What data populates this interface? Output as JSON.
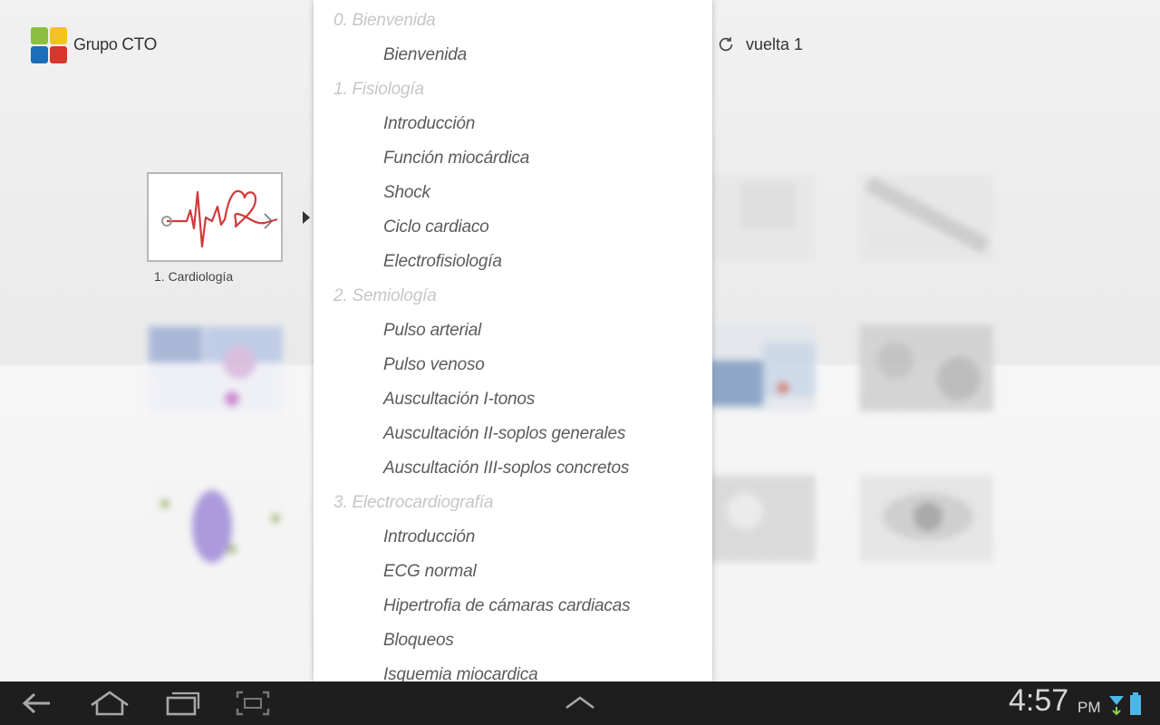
{
  "header": {
    "brand_prefix": "Grupo",
    "brand_name": "CTO",
    "lap_label": "vuelta 1"
  },
  "tiles": [
    {
      "label": "1. Cardiología",
      "selected": true
    },
    {
      "label": "",
      "selected": false
    }
  ],
  "menu": {
    "items": [
      {
        "type": "section",
        "label": "0. Bienvenida"
      },
      {
        "type": "topic",
        "label": "Bienvenida"
      },
      {
        "type": "section",
        "label": "1. Fisiología"
      },
      {
        "type": "topic",
        "label": "Introducción"
      },
      {
        "type": "topic",
        "label": "Función miocárdica"
      },
      {
        "type": "topic",
        "label": "Shock"
      },
      {
        "type": "topic",
        "label": "Ciclo cardiaco"
      },
      {
        "type": "topic",
        "label": "Electrofisiología"
      },
      {
        "type": "section",
        "label": "2. Semiología"
      },
      {
        "type": "topic",
        "label": "Pulso arterial"
      },
      {
        "type": "topic",
        "label": "Pulso venoso"
      },
      {
        "type": "topic",
        "label": "Auscultación I-tonos"
      },
      {
        "type": "topic",
        "label": "Auscultación II-soplos generales"
      },
      {
        "type": "topic",
        "label": "Auscultación III-soplos concretos"
      },
      {
        "type": "section",
        "label": "3. Electrocardiografía"
      },
      {
        "type": "topic",
        "label": "Introducción"
      },
      {
        "type": "topic",
        "label": "ECG normal"
      },
      {
        "type": "topic",
        "label": "Hipertrofia de cámaras cardiacas"
      },
      {
        "type": "topic",
        "label": "Bloqueos"
      },
      {
        "type": "topic",
        "label": "Isquemia miocardica"
      }
    ]
  },
  "statusbar": {
    "time": "4:57",
    "ampm": "PM"
  },
  "colors": {
    "brand_green": "#8cbf3f",
    "brand_yellow": "#f3c41f",
    "brand_blue": "#1d6eb8",
    "brand_red": "#d8352d",
    "ecg_red": "#d23a3a",
    "battery_blue": "#4db6e8"
  },
  "icons": [
    "refresh-icon",
    "back-icon",
    "home-icon",
    "recent-apps-icon",
    "screenshot-icon",
    "chevron-up-icon",
    "signal-icon",
    "battery-icon"
  ]
}
